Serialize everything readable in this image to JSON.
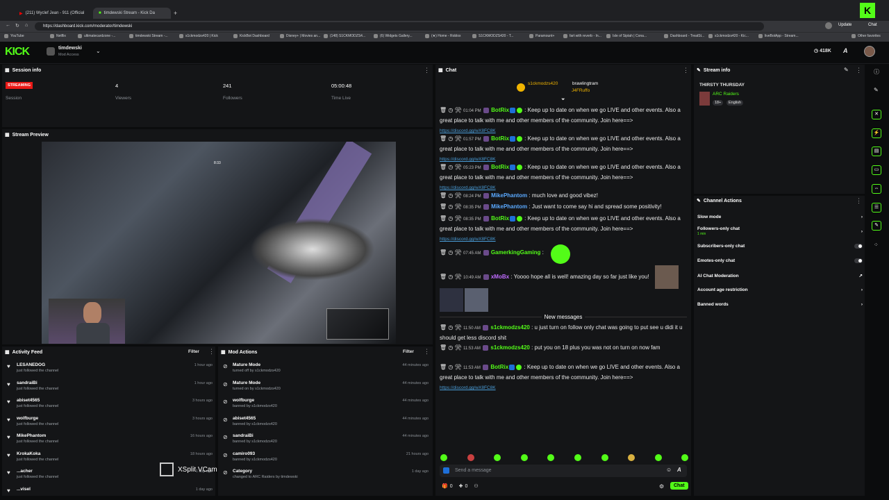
{
  "browser": {
    "tabs": [
      {
        "label": "(211) Wyclef Jean - 911 (Official"
      },
      {
        "label": "timdewski Stream - Kick Da"
      }
    ],
    "url": "https://dashboard.kick.com/moderator/timdewski",
    "update": "Update",
    "chat": "Chat",
    "bookmarks": [
      "YouTube",
      "Netflix",
      "ultimatecardzone -...",
      "timdewski Stream -...",
      "s1ckmodzs420 | Kick",
      "KickBot Dashboard",
      "Disney+ | Movies an...",
      "(148) S1CKMODZS4...",
      "(6) Widgets Gallery...",
      "(★) Home - Roblox",
      "S1CKMODZS420 - T...",
      "Paramount+",
      "fart with reverb - In...",
      "Isle of Siptah | Cona...",
      "Dashboard - TreatSt...",
      "s1ckmodzs420 - Kic...",
      "liveBotApp - Stream...",
      "Other favorites"
    ]
  },
  "header": {
    "logo": "KICK",
    "channel": "timdewski",
    "role": "Mod Access",
    "viewers": "418K"
  },
  "session": {
    "title": "Session info",
    "status": "STREAMING",
    "session_label": "Session",
    "stats": [
      {
        "n": "4",
        "l": "Viewers"
      },
      {
        "n": "241",
        "l": "Followers"
      },
      {
        "n": "05:00:48",
        "l": "Time Live"
      }
    ]
  },
  "preview": {
    "title": "Stream Preview",
    "cam_label": "XSplit VCam",
    "hud_time": "8:33"
  },
  "activity": {
    "title": "Activity Feed",
    "filter": "Filter",
    "items": [
      {
        "name": "LESANEDOG",
        "sub": "just followed the channel",
        "time": "1 hour ago"
      },
      {
        "name": "sandraiBi",
        "sub": "just followed the channel",
        "time": "1 hour ago"
      },
      {
        "name": "abiset4565",
        "sub": "just followed the channel",
        "time": "3 hours ago"
      },
      {
        "name": "wolfburge",
        "sub": "just followed the channel",
        "time": "3 hours ago"
      },
      {
        "name": "MikePhantom",
        "sub": "just followed the channel",
        "time": "16 hours ago"
      },
      {
        "name": "KrokaKoka",
        "sub": "just followed the channel",
        "time": "18 hours ago"
      },
      {
        "name": "...acher",
        "sub": "just followed the channel",
        "time": "1 day ago"
      },
      {
        "name": "...visel",
        "sub": "",
        "time": "1 day ago"
      }
    ]
  },
  "mod": {
    "title": "Mod Actions",
    "filter": "Filter",
    "items": [
      {
        "name": "Mature Mode",
        "sub": "turned off by s1ckmodzs420",
        "time": "44 minutes ago"
      },
      {
        "name": "Mature Mode",
        "sub": "turned on by s1ckmodzs420",
        "time": "44 minutes ago"
      },
      {
        "name": "wolfburge",
        "sub": "banned by s1ckmodzs420",
        "time": "44 minutes ago"
      },
      {
        "name": "abiset4565",
        "sub": "banned by s1ckmodzs420",
        "time": "44 minutes ago"
      },
      {
        "name": "sandraiBi",
        "sub": "banned by s1ckmodzs420",
        "time": "44 minutes ago"
      },
      {
        "name": "camiro093",
        "sub": "banned by s1ckmodzs420",
        "time": "21 hours ago"
      },
      {
        "name": "Category",
        "sub": "changed to ARC Raiders by timdewski",
        "time": "1 day ago"
      }
    ]
  },
  "chat": {
    "title": "Chat",
    "pinned": [
      {
        "name": "s1ckmodzs420",
        "v": "2"
      },
      {
        "name": "brawlingtram",
        "v": "2"
      },
      {
        "name": "J4FRuffo",
        "v": "1"
      }
    ],
    "link": "https://discord.gg/wX8FC8K",
    "bot_text": "Keep up to date on when we go LIVE and other events. Also a great place to talk with me and other members of the community. Join here==>",
    "messages": [
      {
        "time": "01:04 PM",
        "user": "BotRix"
      },
      {
        "time": "01:57 PM",
        "user": "BotRix"
      },
      {
        "time": "05:23 PM",
        "user": "BotRix"
      },
      {
        "time": "08:24 PM",
        "user": "MikePhantom",
        "text": "much love and good vibez!"
      },
      {
        "time": "08:35 PM",
        "user": "MikePhantom",
        "text": "Just want to come say hi and spread some positivity!"
      },
      {
        "time": "08:35 PM",
        "user": "BotRix"
      },
      {
        "time": "07:45 AM",
        "user": "GamerkingGaming",
        "text": ""
      },
      {
        "time": "10:49 AM",
        "user": "xMoBx",
        "text": "Yoooo hope all is well! amazing day so far just like you!"
      },
      {
        "time": "11:50 AM",
        "user": "s1ckmodzs420",
        "text": "u just turn on follow only chat was going to put see u didi it u should get less discord shit"
      },
      {
        "time": "11:53 AM",
        "user": "s1ckmodzs420",
        "text": "put you on 18 plus you was not on turn on now fam"
      },
      {
        "time": "11:53 AM",
        "user": "BotRix"
      }
    ],
    "new_messages": "New messages",
    "placeholder": "Send a message",
    "send": "Chat",
    "count_a": "0",
    "count_b": "0"
  },
  "info": {
    "title": "Stream info",
    "stream_title": "THIRSTY THURSDAY",
    "category": "ARC Raiders",
    "rating": "18+",
    "lang": "English"
  },
  "actions": {
    "title": "Channel Actions",
    "items": [
      {
        "label": "Slow mode"
      },
      {
        "label": "Followers-only chat",
        "sub": "1 min"
      },
      {
        "label": "Subscribers-only chat"
      },
      {
        "label": "Emotes-only chat"
      },
      {
        "label": "AI Chat Moderation"
      },
      {
        "label": "Account age restriction"
      },
      {
        "label": "Banned words"
      }
    ]
  },
  "colors": {
    "accent": "#53fc18",
    "link": "#4a9dd8",
    "live": "#e91916"
  }
}
